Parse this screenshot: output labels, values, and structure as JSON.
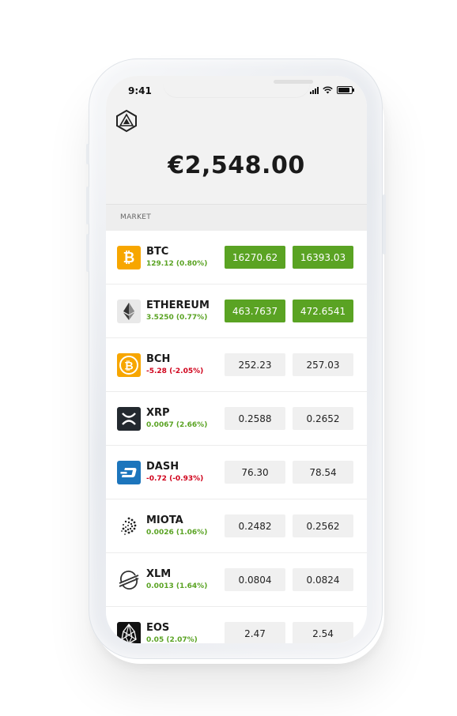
{
  "status": {
    "time": "9:41"
  },
  "balance": "€2,548.00",
  "section": {
    "label": "MARKET"
  },
  "colors": {
    "up": "#5aa323",
    "down": "#d0021b",
    "highlight": "#5aa323"
  },
  "coins": [
    {
      "symbol": "BTC",
      "change": "129.12 (0.80%)",
      "direction": "up",
      "bid": "16270.62",
      "ask": "16393.03",
      "highlight": true,
      "icon": "bitcoin-icon"
    },
    {
      "symbol": "ETHEREUM",
      "change": "3.5250 (0.77%)",
      "direction": "up",
      "bid": "463.7637",
      "ask": "472.6541",
      "highlight": true,
      "icon": "ethereum-icon"
    },
    {
      "symbol": "BCH",
      "change": "-5.28 (-2.05%)",
      "direction": "down",
      "bid": "252.23",
      "ask": "257.03",
      "highlight": false,
      "icon": "bitcoin-cash-icon"
    },
    {
      "symbol": "XRP",
      "change": "0.0067 (2.66%)",
      "direction": "up",
      "bid": "0.2588",
      "ask": "0.2652",
      "highlight": false,
      "icon": "xrp-icon"
    },
    {
      "symbol": "DASH",
      "change": "-0.72 (-0.93%)",
      "direction": "down",
      "bid": "76.30",
      "ask": "78.54",
      "highlight": false,
      "icon": "dash-icon"
    },
    {
      "symbol": "MIOTA",
      "change": "0.0026 (1.06%)",
      "direction": "up",
      "bid": "0.2482",
      "ask": "0.2562",
      "highlight": false,
      "icon": "iota-icon"
    },
    {
      "symbol": "XLM",
      "change": "0.0013 (1.64%)",
      "direction": "up",
      "bid": "0.0804",
      "ask": "0.0824",
      "highlight": false,
      "icon": "stellar-icon"
    },
    {
      "symbol": "EOS",
      "change": "0.05 (2.07%)",
      "direction": "up",
      "bid": "2.47",
      "ask": "2.54",
      "highlight": false,
      "icon": "eos-icon"
    }
  ]
}
